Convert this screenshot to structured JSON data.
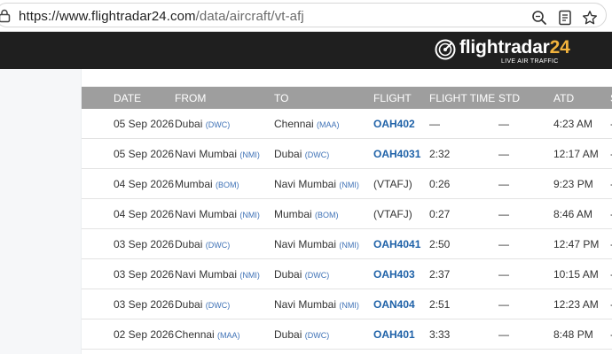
{
  "browser": {
    "url_host": "https://www.flightradar24.com",
    "url_path": "/data/aircraft/vt-afj"
  },
  "header": {
    "logo_main": "flightradar",
    "logo_accent": "24",
    "logo_tagline": "LIVE AIR TRAFFIC",
    "bg_color": "#1f1f1f",
    "accent_color": "#f2b33d"
  },
  "table": {
    "columns": [
      "DATE",
      "FROM",
      "TO",
      "FLIGHT",
      "FLIGHT TIME",
      "STD",
      "ATD",
      "S"
    ],
    "rows": [
      {
        "date": "05 Sep 2026",
        "from_city": "Dubai",
        "from_code": "(DWC)",
        "to_city": "Chennai",
        "to_code": "(MAA)",
        "flight": "OAH402",
        "flight_is_link": true,
        "flight_time": "—",
        "std": "—",
        "atd": "4:23 AM",
        "s": "-"
      },
      {
        "date": "05 Sep 2026",
        "from_city": "Navi Mumbai",
        "from_code": "(NMI)",
        "to_city": "Dubai",
        "to_code": "(DWC)",
        "flight": "OAH4031",
        "flight_is_link": true,
        "flight_time": "2:32",
        "std": "—",
        "atd": "12:17 AM",
        "s": "-"
      },
      {
        "date": "04 Sep 2026",
        "from_city": "Mumbai",
        "from_code": "(BOM)",
        "to_city": "Navi Mumbai",
        "to_code": "(NMI)",
        "flight": "(VTAFJ)",
        "flight_is_link": false,
        "flight_time": "0:26",
        "std": "—",
        "atd": "9:23 PM",
        "s": "-"
      },
      {
        "date": "04 Sep 2026",
        "from_city": "Navi Mumbai",
        "from_code": "(NMI)",
        "to_city": "Mumbai",
        "to_code": "(BOM)",
        "flight": "(VTAFJ)",
        "flight_is_link": false,
        "flight_time": "0:27",
        "std": "—",
        "atd": "8:46 AM",
        "s": "-"
      },
      {
        "date": "03 Sep 2026",
        "from_city": "Dubai",
        "from_code": "(DWC)",
        "to_city": "Navi Mumbai",
        "to_code": "(NMI)",
        "flight": "OAH4041",
        "flight_is_link": true,
        "flight_time": "2:50",
        "std": "—",
        "atd": "12:47 PM",
        "s": "-"
      },
      {
        "date": "03 Sep 2026",
        "from_city": "Navi Mumbai",
        "from_code": "(NMI)",
        "to_city": "Dubai",
        "to_code": "(DWC)",
        "flight": "OAH403",
        "flight_is_link": true,
        "flight_time": "2:37",
        "std": "—",
        "atd": "10:15 AM",
        "s": "-"
      },
      {
        "date": "03 Sep 2026",
        "from_city": "Dubai",
        "from_code": "(DWC)",
        "to_city": "Navi Mumbai",
        "to_code": "(NMI)",
        "flight": "OAN404",
        "flight_is_link": true,
        "flight_time": "2:51",
        "std": "—",
        "atd": "12:23 AM",
        "s": "-"
      },
      {
        "date": "02 Sep 2026",
        "from_city": "Chennai",
        "from_code": "(MAA)",
        "to_city": "Dubai",
        "to_code": "(DWC)",
        "flight": "OAH401",
        "flight_is_link": true,
        "flight_time": "3:33",
        "std": "—",
        "atd": "8:48 PM",
        "s": "-"
      }
    ]
  },
  "icons": {
    "site_info": "site-info-icon",
    "search": "search-icon",
    "reader": "reader-mode-icon",
    "favorite": "star-icon"
  }
}
